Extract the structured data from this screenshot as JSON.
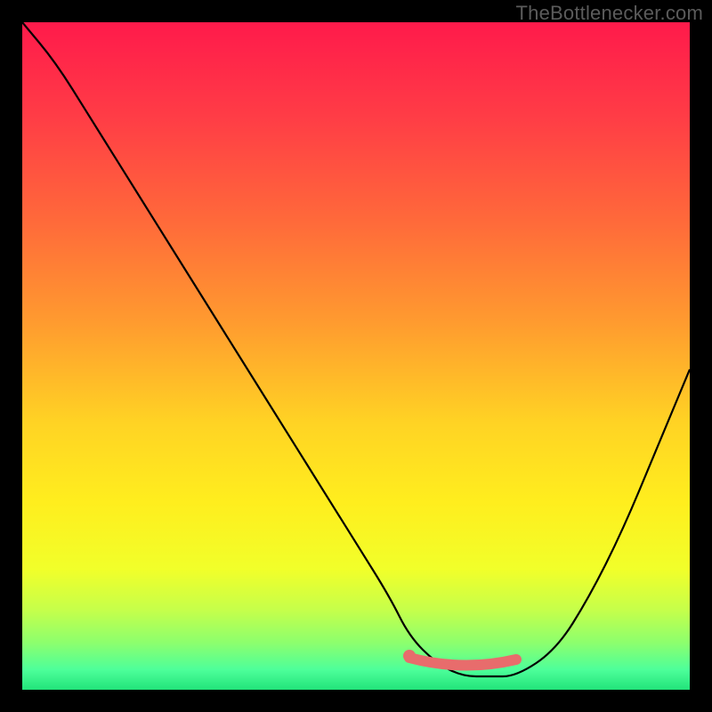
{
  "attribution": "TheBottlenecker.com",
  "chart_data": {
    "type": "line",
    "title": "",
    "xlabel": "",
    "ylabel": "",
    "xlim": [
      0,
      100
    ],
    "ylim": [
      0,
      100
    ],
    "x": [
      0,
      5,
      10,
      15,
      20,
      25,
      30,
      35,
      40,
      45,
      50,
      55,
      58,
      62,
      66,
      70,
      74,
      80,
      85,
      90,
      95,
      100
    ],
    "y": [
      100,
      94,
      86,
      78,
      70,
      62,
      54,
      46,
      38,
      30,
      22,
      14,
      8,
      4,
      2,
      2,
      2,
      6,
      14,
      24,
      36,
      48
    ],
    "highlight_band": {
      "x_start": 58,
      "x_end": 74,
      "y": 4
    },
    "background_gradient": {
      "stops": [
        {
          "offset": 0.0,
          "color": "#ff1a4b"
        },
        {
          "offset": 0.14,
          "color": "#ff3c46"
        },
        {
          "offset": 0.3,
          "color": "#ff6a3a"
        },
        {
          "offset": 0.45,
          "color": "#ff9b2f"
        },
        {
          "offset": 0.6,
          "color": "#ffd324"
        },
        {
          "offset": 0.72,
          "color": "#ffee1e"
        },
        {
          "offset": 0.82,
          "color": "#f1ff2a"
        },
        {
          "offset": 0.88,
          "color": "#c6ff4a"
        },
        {
          "offset": 0.93,
          "color": "#8cff6e"
        },
        {
          "offset": 0.97,
          "color": "#4dff9a"
        },
        {
          "offset": 1.0,
          "color": "#22e37a"
        }
      ]
    }
  }
}
